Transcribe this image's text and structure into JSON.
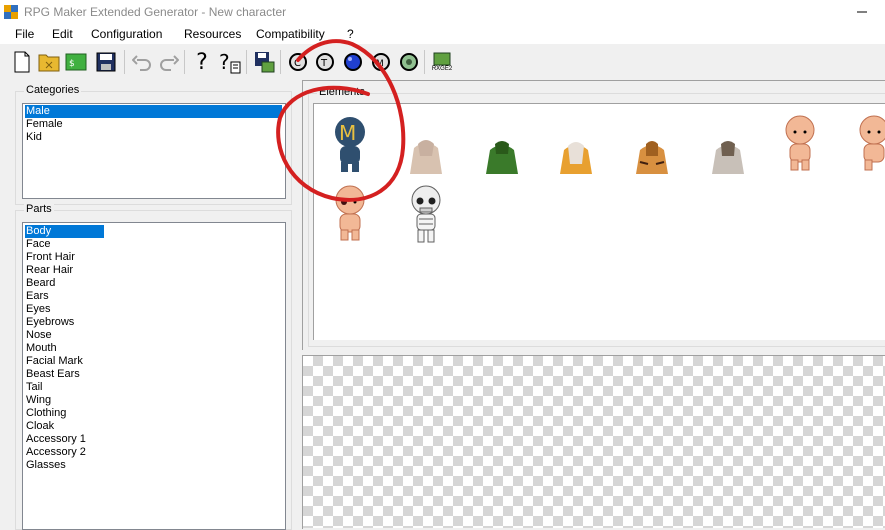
{
  "window": {
    "title": "RPG Maker Extended Generator - New character",
    "minimize_icon": "minimize-icon"
  },
  "menu": {
    "items": [
      "File",
      "Edit",
      "Configuration",
      "Resources",
      "Compatibility",
      "?"
    ]
  },
  "toolbar": {
    "buttons": [
      "new-file-icon",
      "open-folder-icon",
      "random-icon",
      "save-icon",
      "undo-icon",
      "redo-icon",
      "help-icon",
      "help-topic-icon",
      "export-icon",
      "c-badge-icon",
      "t-badge-icon",
      "blue-orb-icon",
      "m-badge-icon",
      "compass-icon",
      "rxge2-icon"
    ],
    "rxge2_label": "RXGE2"
  },
  "categories": {
    "label": "Categories",
    "items": [
      "Male",
      "Female",
      "Kid"
    ],
    "selected": "Male"
  },
  "parts": {
    "label": "Parts",
    "items": [
      "Body",
      "Face",
      "Front Hair",
      "Rear Hair",
      "Beard",
      "Ears",
      "Eyes",
      "Eyebrows",
      "Nose",
      "Mouth",
      "Facial Mark",
      "Beast Ears",
      "Tail",
      "Wing",
      "Clothing",
      "Cloak",
      "Accessory 1",
      "Accessory 2",
      "Glasses"
    ],
    "selected": "Body"
  },
  "elements": {
    "label": "Elements",
    "items": [
      {
        "name": "male-placeholder",
        "letter": "M",
        "color": "#2f4f6f"
      },
      {
        "name": "beige-torso",
        "color": "#d8c2b0"
      },
      {
        "name": "green-torso",
        "color": "#3a7a2a"
      },
      {
        "name": "orange-white-torso",
        "color": "#e8a030"
      },
      {
        "name": "tiger-torso",
        "color": "#d89040"
      },
      {
        "name": "grey-torso",
        "color": "#a89888"
      },
      {
        "name": "bald-body-1",
        "color": "#f2b896"
      },
      {
        "name": "bald-body-2",
        "color": "#f2b896"
      },
      {
        "name": "bald-body-3",
        "color": "#f2b896"
      },
      {
        "name": "skeleton-body",
        "color": "#e8e8e8"
      }
    ]
  },
  "colors": {
    "selection": "#0078d7",
    "annotation": "#d42020"
  }
}
